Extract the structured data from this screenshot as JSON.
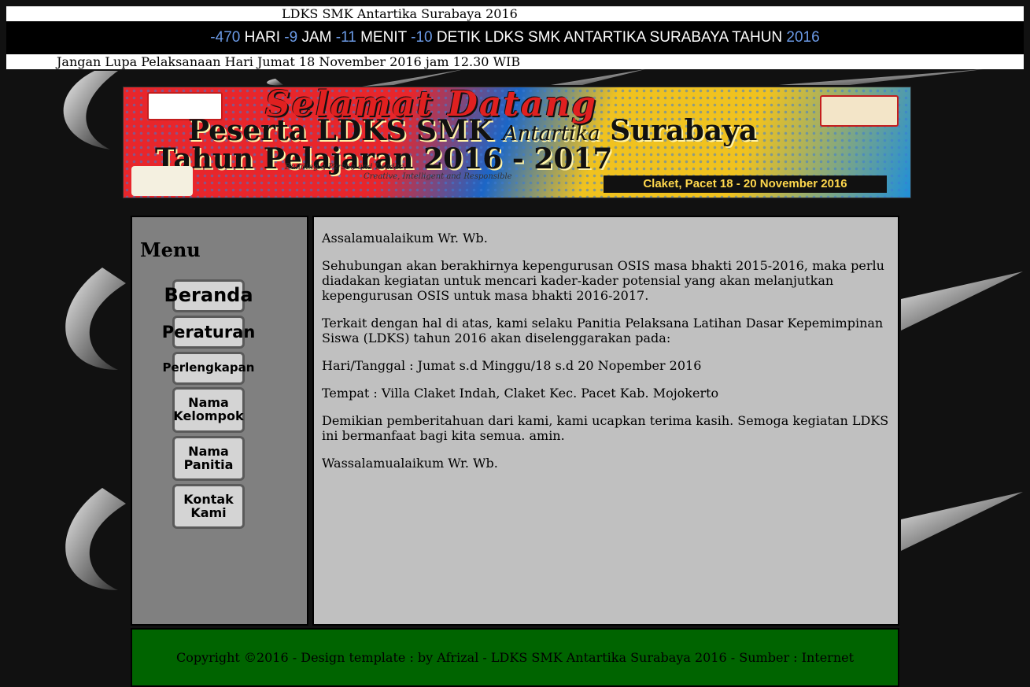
{
  "site_title": "LDKS SMK Antartika Surabaya 2016",
  "countdown": {
    "days": "-470",
    "days_label": "HARI",
    "hours": "-9",
    "hours_label": "JAM",
    "minutes": "-11",
    "minutes_label": "MENIT",
    "seconds": "-10",
    "seconds_label": "DETIK LDKS SMK ANTARTIKA SURABAYA TAHUN",
    "year": "2016"
  },
  "marquee": "Jangan Lupa Pelaksanaan Hari Jumat 18 November 2016 jam 12.30 WIB",
  "banner": {
    "line1": "Selamat Datang",
    "line2a": "Peserta LDKS SMK",
    "line2b": "Antartika",
    "line2c": "Surabaya",
    "line3": "Tahun Pelajaran 2016 - 2017",
    "tagline1": "Building a Person and Leader",
    "tagline2": "Creative, Intelligent and Responsible",
    "place": "Claket, Pacet 18 - 20 November 2016"
  },
  "sidebar": {
    "heading": "Menu",
    "items": [
      {
        "label": "Beranda"
      },
      {
        "label": "Peraturan"
      },
      {
        "label": "Perlengkapan"
      },
      {
        "label": "Nama Kelompok"
      },
      {
        "label": "Nama Panitia"
      },
      {
        "label": "Kontak Kami"
      }
    ]
  },
  "content": {
    "paragraphs": [
      "Assalamualaikum Wr. Wb.",
      "Sehubungan akan berakhirnya kepengurusan OSIS masa bhakti 2015-2016, maka perlu diadakan kegiatan untuk mencari kader-kader potensial yang akan melanjutkan kepengurusan OSIS untuk masa bhakti 2016-2017.",
      "Terkait dengan hal di atas, kami selaku Panitia Pelaksana Latihan Dasar Kepemimpinan Siswa (LDKS) tahun 2016 akan diselenggarakan pada:",
      "Hari/Tanggal : Jumat s.d Minggu/18 s.d 20 Nopember 2016",
      "Tempat : Villa Claket Indah, Claket Kec. Pacet Kab. Mojokerto",
      "Demikian pemberitahuan dari kami, kami ucapkan terima kasih. Semoga kegiatan LDKS ini bermanfaat bagi kita semua. amin.",
      "Wassalamualaikum Wr. Wb."
    ]
  },
  "footer": "Copyright ©2016 - Design template : by Afrizal - LDKS SMK Antartika Surabaya 2016 - Sumber : Internet",
  "colors": {
    "countdown_number": "#6b9ae6",
    "footer_bg": "#006400",
    "content_bg": "#c0c0c0",
    "sidebar_bg": "#808080"
  }
}
